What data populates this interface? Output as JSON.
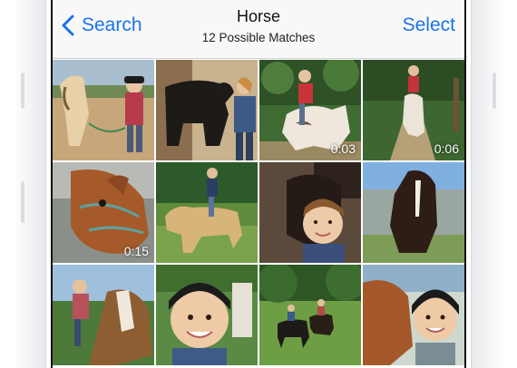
{
  "nav": {
    "back_label": "Search",
    "title": "Horse",
    "subtitle": "12 Possible Matches",
    "select_label": "Select"
  },
  "accent_color": "#1a73e8",
  "photos": [
    {
      "id": "photo-1",
      "duration": ""
    },
    {
      "id": "photo-2",
      "duration": ""
    },
    {
      "id": "photo-3",
      "duration": "0:03"
    },
    {
      "id": "photo-4",
      "duration": "0:06"
    },
    {
      "id": "photo-5",
      "duration": "0:15"
    },
    {
      "id": "photo-6",
      "duration": ""
    },
    {
      "id": "photo-7",
      "duration": ""
    },
    {
      "id": "photo-8",
      "duration": ""
    },
    {
      "id": "photo-9",
      "duration": ""
    },
    {
      "id": "photo-10",
      "duration": ""
    },
    {
      "id": "photo-11",
      "duration": ""
    },
    {
      "id": "photo-12",
      "duration": ""
    }
  ]
}
